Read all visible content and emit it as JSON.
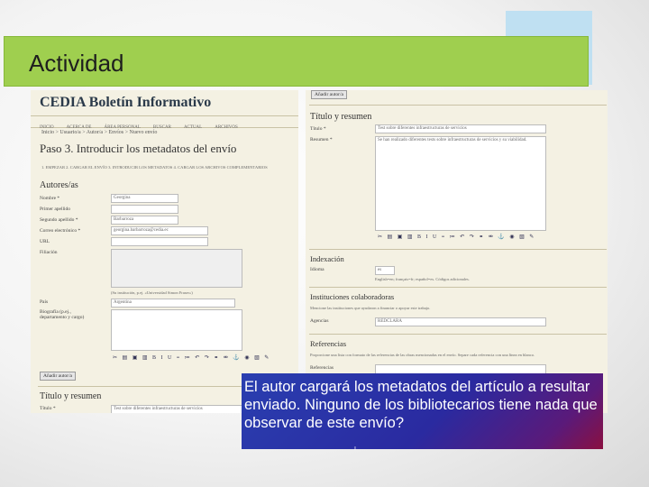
{
  "slide": {
    "title": "Actividad",
    "caption": "El autor cargará los metadatos del artículo a resultar enviado. Ninguno de los bibliotecarios tiene nada que observar de este envío?",
    "caption_dot": "ı"
  },
  "left_screen": {
    "brand": "CEDIA Boletín Informativo",
    "nav": [
      "INICIO",
      "ACERCA DE",
      "ÁREA PERSONAL",
      "BUSCAR",
      "ACTUAL",
      "ARCHIVOS"
    ],
    "breadcrumb": "Inicio > Usuario/a > Autor/a > Envíos > Nuevo envío",
    "heading": "Paso 3. Introducir los metadatos del envío",
    "steps": "1. EMPEZAR  2. CARGAR EL ENVÍO  3. INTRODUCIR LOS METADATOS  4. CARGAR LOS ARCHIVOS COMPLEMENTARIOS",
    "authors_heading": "Autores/as",
    "fields": {
      "nombre_label": "Nombre *",
      "nombre_value": "Georgina",
      "primer_label": "Primer apellido",
      "segundo_label": "Segundo apellido *",
      "segundo_value": "Barbarroza",
      "correo_label": "Correo electrónico *",
      "correo_value": "georgina.barbarroza@cedia.ec",
      "url_label": "URL",
      "filiacion_label": "Filiación",
      "filiacion_hint": "(Su institución, p.ej. «Universidad Simon Fraser»)",
      "pais_label": "País",
      "pais_value": "Argentina",
      "biografia_label": "Biografía (p.ej., departamento y cargo)",
      "add_author_button": "Añadir autor/a"
    },
    "title_heading": "Título y resumen",
    "titulo_label": "Título *",
    "titulo_value": "Test sobre diferentes infraestructuras de servicios"
  },
  "right_screen": {
    "top_button": "Añadir autor/a",
    "title_heading": "Título y resumen",
    "titulo_label": "Título *",
    "titulo_value": "Test sobre diferentes infraestructuras de servicios",
    "resumen_label": "Resumen *",
    "resumen_value": "Se han realizado diferentes tests sobre infraestructuras de servicios y su viabilidad.",
    "index_heading": "Indexación",
    "idioma_label": "Idioma",
    "idioma_value": "es",
    "idioma_hint": "English=en; français=fr; español=es. Códigos adicionales.",
    "inst_heading": "Instituciones colaboradoras",
    "inst_hint": "Mencione las instituciones que ayudaron a financiar o apoyar este trabajo.",
    "agencias_label": "Agencias",
    "agencias_value": "REDCLARA",
    "ref_heading": "Referencias",
    "ref_hint": "Proporcione una lista con formato de las referencias de las obras mencionadas en el envío. Separe cada referencia con una línea en blanco.",
    "ref_label": "Referencias"
  },
  "toolbar_glyphs": "✂ ▤ ▣ ▥ B I U ≡ ≔ ↶ ↷ ⚭ ⚮ ⚓ ◉ ▧ ✎"
}
